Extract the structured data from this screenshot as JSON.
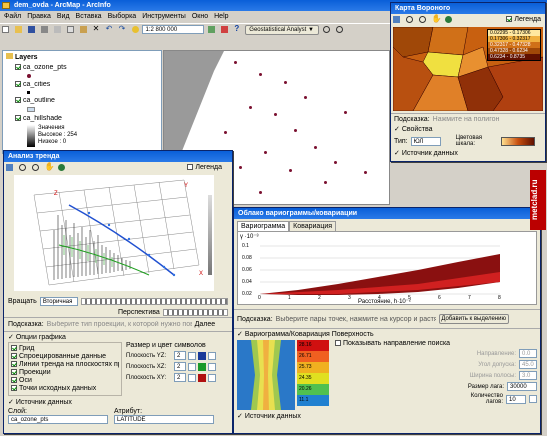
{
  "app": {
    "title": "dem_ovda - ArcMap - ArcInfo",
    "menu": [
      "Файл",
      "Правка",
      "Вид",
      "Вставка",
      "Выборка",
      "Инструменты",
      "Окно",
      "Help"
    ],
    "scale": "1:2 800 000",
    "geo_toolbar": "Geostatistical Analyst ▼"
  },
  "toc": {
    "root": "Layers",
    "layers": [
      {
        "name": "ca_ozone_pts",
        "checked": true
      },
      {
        "name": "ca_cities",
        "checked": true
      },
      {
        "name": "ca_outline",
        "checked": true
      },
      {
        "name": "ca_hillshade",
        "checked": true
      }
    ],
    "legend_lines": [
      "Значения",
      "Высокое : 254",
      "Низкое : 0"
    ]
  },
  "trend": {
    "title": "Анализ тренда",
    "legend_label": "Легенда",
    "rotate_label": "Вращать",
    "rotate_value": "Вторичная",
    "perspective_label": "Перспектива",
    "hint_label": "Подсказка:",
    "hint_text": "Выберите тип проекции, к которой нужно поворачивать",
    "hint_button": "Далее",
    "options_header": "Опции графика",
    "options": [
      {
        "label": "Грид",
        "checked": true
      },
      {
        "label": "Спроецированные данные",
        "checked": true
      },
      {
        "label": "Линии тренда на плоскостях проекции",
        "checked": true
      },
      {
        "label": "Проекции",
        "checked": true
      },
      {
        "label": "Оси",
        "checked": true
      },
      {
        "label": "Точки исходных данных",
        "checked": true
      }
    ],
    "size_header": "Размер и цвет символов",
    "planes": [
      {
        "label": "Плоскость YZ:",
        "value": "2"
      },
      {
        "label": "Плоскость XZ:",
        "value": "2"
      },
      {
        "label": "Плоскость XY:",
        "value": "2"
      }
    ],
    "plane_colors": [
      "#1a3a9a",
      "#1a9a2a",
      "#b01010"
    ],
    "source_header": "Источник данных",
    "layer_label": "Слой:",
    "layer_value": "ca_ozone_pts",
    "attr_label": "Атрибут:",
    "attr_value": "LATITUDE"
  },
  "voronoi": {
    "title": "Карта Вороного",
    "legend_label": "Легенда",
    "legend_values": [
      "0.02295 - 0.17306",
      "0.17306 - 0.32317",
      "0.32317 - 0.47328",
      "0.47328 - 0.6234",
      "0.6234 - 0.8735"
    ],
    "hint_label": "Подсказка:",
    "hint_text": "Нажмите на полигон",
    "props_header": "Свойства",
    "type_label": "Тип:",
    "type_value": "ЮЛ",
    "palette_label": "Цветовая шкала:",
    "source_header": "Источник данных"
  },
  "variogram": {
    "title": "Облако вариограммы/ковариации",
    "tabs": [
      "Вариограмма",
      "Ковариация"
    ],
    "y_label": "γ ·10⁻³",
    "y_ticks": [
      "0.1",
      "0.08",
      "0.06",
      "0.04",
      "0.02"
    ],
    "x_label": "Расстояние, h·10⁻²",
    "x_ticks": [
      "0",
      "1",
      "2",
      "3",
      "4",
      "5",
      "6",
      "7",
      "8"
    ],
    "hint_label": "Подсказка:",
    "hint_text": "Выберите пары точек, нажмите на курсор и растяните рамку",
    "add_button": "Добавить к выделению",
    "surface_header": "Вариограмма/Ковариация Поверхность",
    "scale_values": [
      "28.16",
      "26.71",
      "25.73",
      "24.35",
      "20.26",
      "11.1"
    ],
    "scale_colors": [
      "#d01010",
      "#f06020",
      "#f0b020",
      "#e0e020",
      "#50c050",
      "#2080d0"
    ],
    "show_dir": "Показывать направление поиска",
    "dir_fields": [
      {
        "label": "Направление:",
        "value": "0.0"
      },
      {
        "label": "Угол допуска:",
        "value": "45.0"
      },
      {
        "label": "Ширина полосы:",
        "value": "3.0"
      }
    ],
    "lag_label": "Размер лага:",
    "lag_value": "30000",
    "count_label": "Количество лагов:",
    "count_value": "10",
    "source_header": "Источник данных"
  },
  "watermark": "metclad.ru"
}
